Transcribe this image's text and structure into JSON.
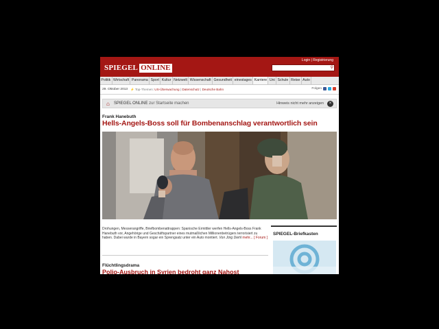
{
  "header": {
    "logo_part1": "SPIEGEL",
    "logo_part2": "ONLINE",
    "login_label": "Login",
    "separator": "|",
    "register_label": "Registrierung"
  },
  "nav": {
    "items": [
      "Politik",
      "Wirtschaft",
      "Panorama",
      "Sport",
      "Kultur",
      "Netzwelt",
      "Wissenschaft",
      "Gesundheit",
      "einestages",
      "Karriere",
      "Uni",
      "Schule",
      "Reise",
      "Auto"
    ]
  },
  "topbar": {
    "date": "29. Oktober 2013",
    "top_themes_label": "Top-Themen:",
    "themes": [
      "US-Überwachung",
      "Datenschutz",
      "Deutsche Bahn"
    ],
    "follow_label": "Folgen"
  },
  "startbar": {
    "brand": "SPIEGEL ONLINE",
    "text": " zur Startseite machen",
    "hide_label": "Hinweis nicht mehr anzeigen",
    "close_symbol": "×"
  },
  "article": {
    "kicker": "Frank Hanebuth",
    "headline": "Hells-Angels-Boss soll für Bombenanschlag verantwortlich sein",
    "teaser": "Drohungen, Messerangriffe, Briefbombenattrappen: Spanische Ermittler werfen Hells-Angels-Boss Frank Hanebuth vor, Angehörige und Geschäftspartner eines mutmaßlichen Millionenbetrügers terrorisiert zu haben. Dabei wurde in Bayern sogar ein Sprengsatz unter ein Auto montiert.",
    "author": "Von Jörg Diehl",
    "more_label": "mehr...",
    "forum_label": "[ Forum ]"
  },
  "article2": {
    "kicker": "Flüchtlingsdrama",
    "headline": "Polio-Ausbruch in Syrien bedroht ganz Nahost"
  },
  "sidebar": {
    "title": "SPIEGEL-Briefkasten"
  },
  "colors": {
    "brand_red": "#a41714",
    "facebook": "#3b5998",
    "twitter": "#2aa9e0",
    "googleplus": "#d23e2b"
  }
}
